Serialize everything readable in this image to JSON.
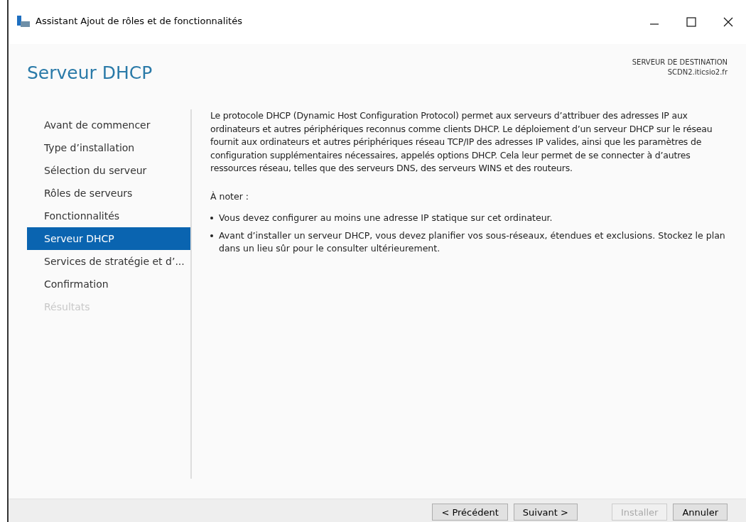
{
  "window": {
    "title": "Assistant Ajout de rôles et de fonctionnalités"
  },
  "page_title": "Serveur DHCP",
  "destination": {
    "label": "SERVEUR DE DESTINATION",
    "server": "SCDN2.iticsio2.fr"
  },
  "steps": [
    {
      "label": "Avant de commencer",
      "selected": false,
      "disabled": false
    },
    {
      "label": "Type d’installation",
      "selected": false,
      "disabled": false
    },
    {
      "label": "Sélection du serveur",
      "selected": false,
      "disabled": false
    },
    {
      "label": "Rôles de serveurs",
      "selected": false,
      "disabled": false
    },
    {
      "label": "Fonctionnalités",
      "selected": false,
      "disabled": false
    },
    {
      "label": "Serveur DHCP",
      "selected": true,
      "disabled": false
    },
    {
      "label": "Services de stratégie et d’...",
      "selected": false,
      "disabled": false
    },
    {
      "label": "Confirmation",
      "selected": false,
      "disabled": false
    },
    {
      "label": "Résultats",
      "selected": false,
      "disabled": true
    }
  ],
  "description": "Le protocole DHCP (Dynamic Host Configuration Protocol) permet aux serveurs d’attribuer des adresses IP aux ordinateurs et autres périphériques reconnus comme clients DHCP. Le déploiement d’un serveur DHCP sur le réseau fournit aux ordinateurs et autres périphériques réseau TCP/IP des adresses IP valides, ainsi que les paramètres de configuration supplémentaires nécessaires, appelés options DHCP. Cela leur permet de se connecter à d’autres ressources réseau, telles que des serveurs DNS, des serveurs WINS et des routeurs.",
  "note_heading": "À noter :",
  "notes": [
    "Vous devez configurer au moins une adresse IP statique sur cet ordinateur.",
    "Avant d’installer un serveur DHCP, vous devez planifier vos sous-réseaux, étendues et exclusions. Stockez le plan dans un lieu sûr pour le consulter ultérieurement."
  ],
  "buttons": [
    {
      "label": "< Précédent",
      "disabled": false
    },
    {
      "label": "Suivant >",
      "disabled": false
    },
    {
      "label": "Installer",
      "disabled": true
    },
    {
      "label": "Annuler",
      "disabled": false
    }
  ]
}
